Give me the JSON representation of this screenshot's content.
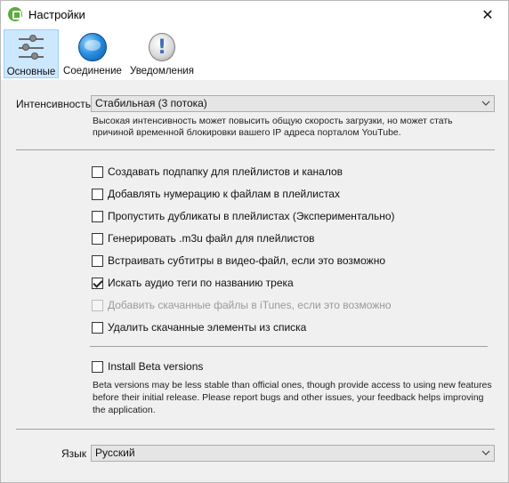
{
  "window": {
    "title": "Настройки",
    "close_glyph": "✕"
  },
  "toolbar": {
    "tabs": [
      {
        "label": "Основные",
        "icon": "sliders-icon",
        "active": true
      },
      {
        "label": "Соединение",
        "icon": "globe-icon",
        "active": false
      },
      {
        "label": "Уведомления",
        "icon": "alert-icon",
        "active": false
      }
    ]
  },
  "intensity": {
    "label": "Интенсивность",
    "value": "Стабильная (3 потока)",
    "note_line1": "Высокая интенсивность может повысить общую скорость загрузки, но может стать",
    "note_line2": "причиной временной блокировки вашего IP адреса порталом YouTube."
  },
  "options": [
    {
      "label": "Создавать подпапку для плейлистов и каналов",
      "checked": false,
      "disabled": false
    },
    {
      "label": "Добавлять нумерацию к файлам в плейлистах",
      "checked": false,
      "disabled": false
    },
    {
      "label": "Пропустить дубликаты в плейлистах (Экспериментально)",
      "checked": false,
      "disabled": false
    },
    {
      "label": "Генерировать .m3u файл для плейлистов",
      "checked": false,
      "disabled": false
    },
    {
      "label": "Встраивать субтитры в видео-файл, если это возможно",
      "checked": false,
      "disabled": false
    },
    {
      "label": "Искать аудио теги по названию трека",
      "checked": true,
      "disabled": false
    },
    {
      "label": "Добавить скачанные файлы в iTunes, если это возможно",
      "checked": false,
      "disabled": true
    },
    {
      "label": "Удалить скачанные элементы из списка",
      "checked": false,
      "disabled": false
    }
  ],
  "beta": {
    "label": "Install Beta versions",
    "checked": false,
    "note_line1": "Beta versions may be less stable than official ones, though provide access to using new features",
    "note_line2": "before their initial release. Please report bugs and other issues, your feedback helps improving",
    "note_line3": "the application."
  },
  "language": {
    "label": "Язык",
    "value": "Русский"
  }
}
